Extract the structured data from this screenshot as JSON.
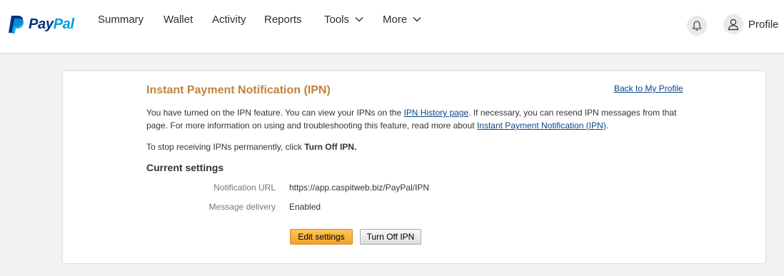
{
  "brand": {
    "pay": "Pay",
    "pal": "Pal",
    "colors": {
      "dark_blue": "#003087",
      "light_blue": "#009cde"
    }
  },
  "nav": {
    "items": [
      {
        "label": "Summary"
      },
      {
        "label": "Wallet"
      },
      {
        "label": "Activity"
      },
      {
        "label": "Reports"
      },
      {
        "label": "Tools",
        "icon": "chevron-down-icon"
      },
      {
        "label": "More",
        "icon": "chevron-down-icon"
      }
    ],
    "notifications_icon": "bell-icon",
    "profile": {
      "label": "Profile",
      "icon": "user-icon"
    }
  },
  "ipn": {
    "title": "Instant Payment Notification (IPN)",
    "back_link": "Back to My Profile",
    "intro": {
      "part1": "You have turned on the IPN feature. You can view your IPNs on the ",
      "history_link": "IPN History page",
      "part2": ". If necessary, you can resend IPN messages from that page. For more information on using and troubleshooting this feature, read more about ",
      "ipn_link": "Instant Payment Notification (IPN)",
      "part3": "."
    },
    "stop": {
      "text": "To stop receiving IPNs permanently, click ",
      "action": "Turn Off IPN."
    },
    "settings": {
      "heading": "Current settings",
      "rows": [
        {
          "label": "Notification URL",
          "value": "https://app.caspitweb.biz/PayPal/IPN"
        },
        {
          "label": "Message delivery",
          "value": "Enabled"
        }
      ]
    },
    "buttons": {
      "edit": "Edit settings",
      "turn_off": "Turn Off IPN"
    },
    "colors": {
      "title": "#c2833f",
      "link": "#084685",
      "primary_button": "#f2a227"
    }
  }
}
